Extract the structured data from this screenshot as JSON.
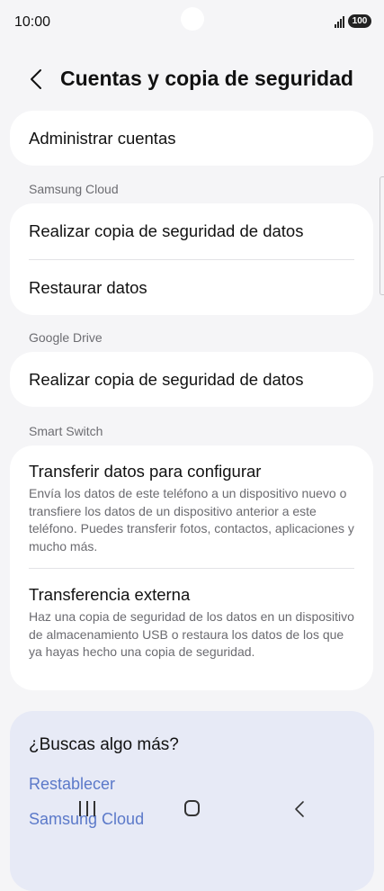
{
  "status_bar": {
    "time": "10:00",
    "battery": "100"
  },
  "header": {
    "title": "Cuentas y copia de seguridad"
  },
  "manage_accounts": {
    "label": "Administrar cuentas"
  },
  "samsung_cloud": {
    "section_label": "Samsung Cloud",
    "backup_label": "Realizar copia de seguridad de datos",
    "restore_label": "Restaurar datos"
  },
  "google_drive": {
    "section_label": "Google Drive",
    "backup_label": "Realizar copia de seguridad de datos"
  },
  "smart_switch": {
    "section_label": "Smart Switch",
    "transfer_title": "Transferir datos para configurar",
    "transfer_desc": "Envía los datos de este teléfono a un dispositivo nuevo o transfiere los datos de un dispositivo anterior a este teléfono. Puedes transferir fotos, contactos, aplicaciones y mucho más.",
    "external_title": "Transferencia externa",
    "external_desc": "Haz una copia de seguridad de los datos en un dispositivo de almacenamiento USB o restaura los datos de los que ya hayas hecho una copia de seguridad."
  },
  "suggestions": {
    "title": "¿Buscas algo más?",
    "links": [
      "Restablecer",
      "Samsung Cloud"
    ]
  },
  "colors": {
    "background": "#f5f5f7",
    "card": "#ffffff",
    "link": "#5b79c9",
    "suggest_bg": "#e7eaf6"
  }
}
